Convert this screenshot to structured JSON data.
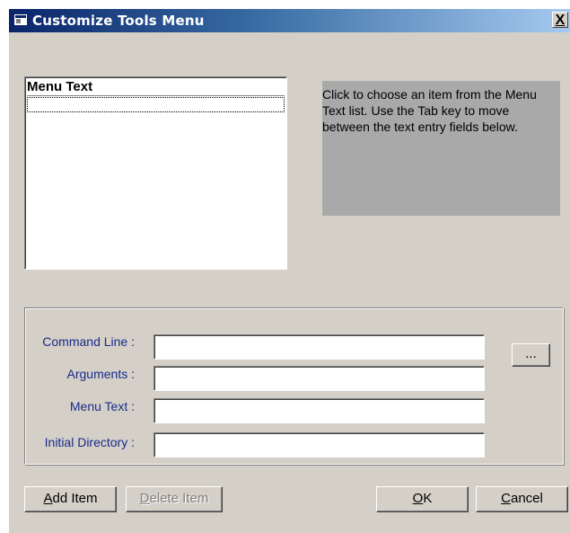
{
  "window": {
    "title": "Customize Tools Menu",
    "close_label": "X"
  },
  "list": {
    "header": "Menu Text",
    "items": [
      ""
    ]
  },
  "help_text": "Click to choose an item from the Menu Text list. Use the Tab key to move between the text entry fields below.",
  "fields": [
    {
      "label": "Command Line :",
      "value": ""
    },
    {
      "label": "Arguments :",
      "value": ""
    },
    {
      "label": "Menu Text :",
      "value": ""
    },
    {
      "label": "Initial Directory :",
      "value": ""
    }
  ],
  "browse_label": "...",
  "buttons": {
    "add_first": "A",
    "add_rest": "dd Item",
    "delete_first": "D",
    "delete_rest": "elete Item",
    "ok_first": "O",
    "ok_rest": "K",
    "cancel_first": "C",
    "cancel_rest": "ancel"
  },
  "colors": {
    "title_start": "#0a246a",
    "title_end": "#a6caf0",
    "dialog_bg": "#d4d0c8",
    "label_blue": "#1a2a8a",
    "help_bg": "#a9a9a9"
  }
}
